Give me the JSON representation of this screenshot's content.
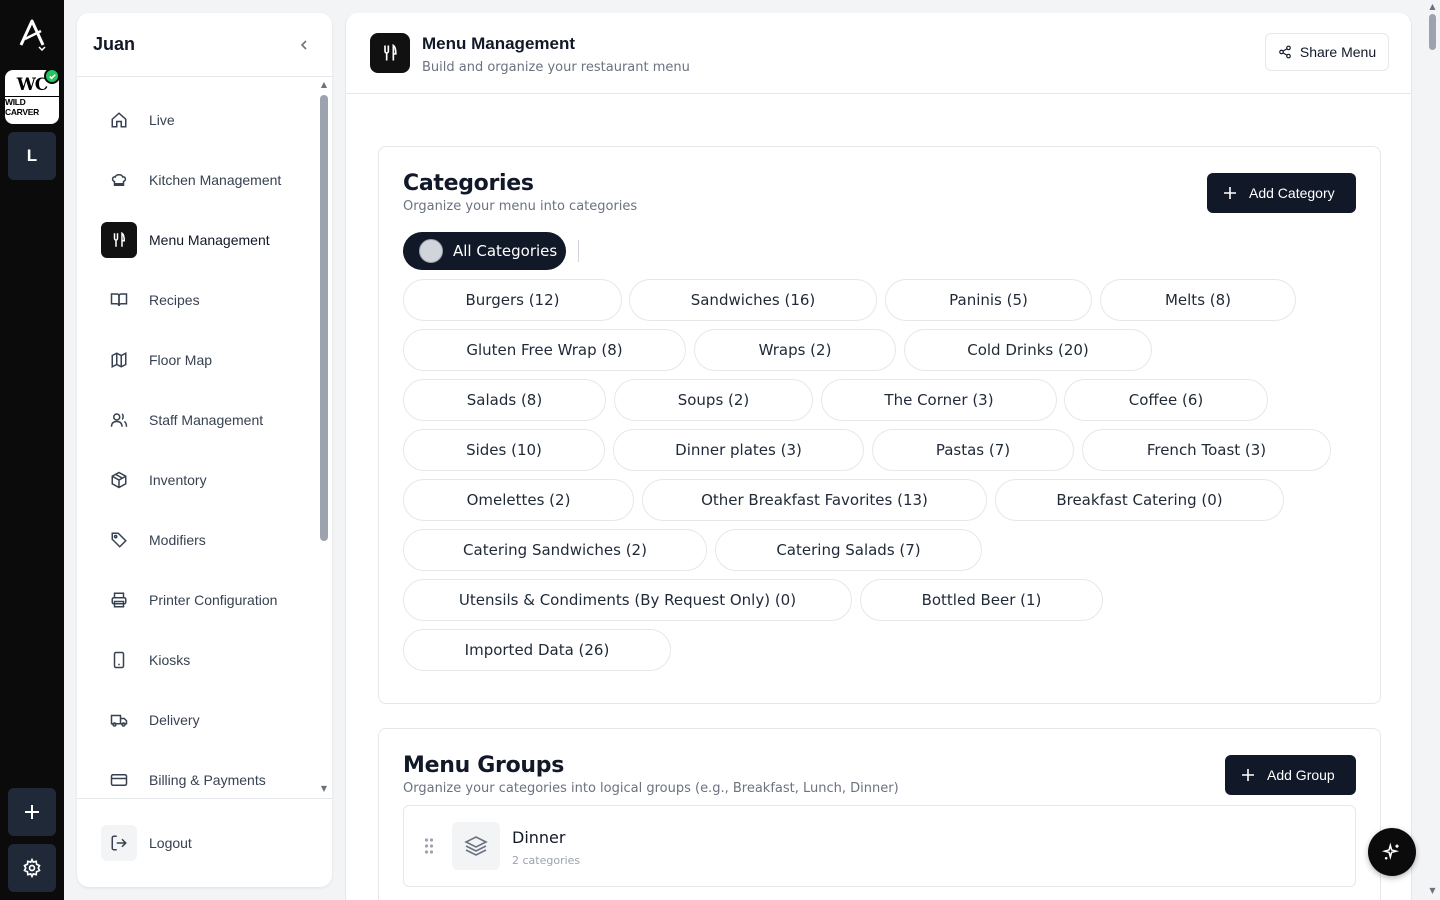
{
  "rail": {
    "brand_mono": "WC",
    "brand_sub": "WILD CARVER",
    "workspace_letter": "L"
  },
  "sidebar": {
    "user_name": "Juan",
    "items": [
      {
        "label": "Live",
        "icon": "home-icon"
      },
      {
        "label": "Kitchen Management",
        "icon": "chef-hat-icon"
      },
      {
        "label": "Menu Management",
        "icon": "utensils-icon",
        "active": true
      },
      {
        "label": "Recipes",
        "icon": "book-open-icon"
      },
      {
        "label": "Floor Map",
        "icon": "map-icon"
      },
      {
        "label": "Staff Management",
        "icon": "users-icon"
      },
      {
        "label": "Inventory",
        "icon": "package-icon"
      },
      {
        "label": "Modifiers",
        "icon": "tag-icon"
      },
      {
        "label": "Printer Configuration",
        "icon": "printer-icon"
      },
      {
        "label": "Kiosks",
        "icon": "tablet-icon"
      },
      {
        "label": "Delivery",
        "icon": "truck-icon"
      },
      {
        "label": "Billing & Payments",
        "icon": "credit-card-icon"
      }
    ],
    "logout_label": "Logout"
  },
  "header": {
    "title": "Menu Management",
    "subtitle": "Build and organize your restaurant menu",
    "share_label": "Share Menu"
  },
  "categories": {
    "title": "Categories",
    "subtitle": "Organize your menu into categories",
    "add_label": "Add Category",
    "all_label": "All Categories",
    "items": [
      "Burgers (12)",
      "Sandwiches (16)",
      "Paninis (5)",
      "Melts (8)",
      "Gluten Free Wrap (8)",
      "Wraps (2)",
      "Cold Drinks (20)",
      "Salads (8)",
      "Soups (2)",
      "The Corner (3)",
      "Coffee (6)",
      "Sides (10)",
      "Dinner plates (3)",
      "Pastas (7)",
      "French Toast (3)",
      "Omelettes (2)",
      "Other Breakfast Favorites (13)",
      "Breakfast Catering (0)",
      "Catering Sandwiches (2)",
      "Catering Salads (7)",
      "Utensils & Condiments (By Request Only) (0)",
      "Bottled Beer (1)",
      "Imported Data (26)"
    ]
  },
  "menu_groups": {
    "title": "Menu Groups",
    "subtitle": "Organize your categories into logical groups (e.g., Breakfast, Lunch, Dinner)",
    "add_label": "Add Group",
    "groups": [
      {
        "name": "Dinner",
        "count": "2 categories"
      }
    ]
  },
  "colors": {
    "dark": "#111827",
    "rail": "#0b0b0c",
    "status_green": "#22c55e"
  }
}
